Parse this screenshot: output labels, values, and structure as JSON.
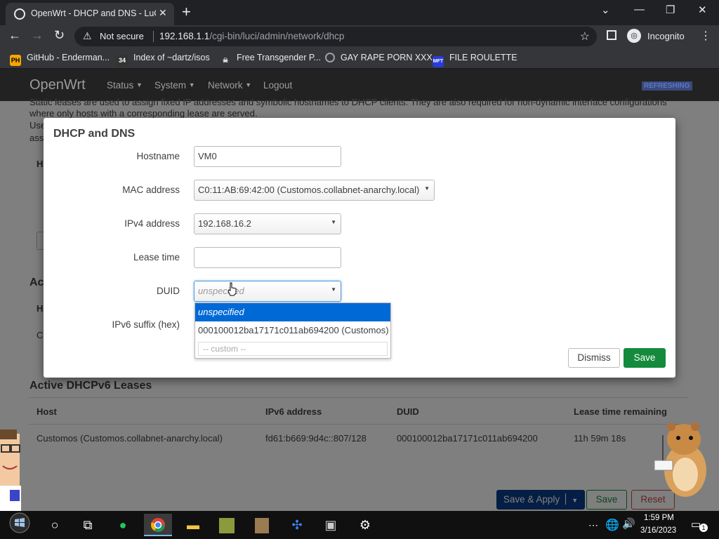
{
  "browser": {
    "tab_title": "OpenWrt - DHCP and DNS - LuCI",
    "not_secure": "Not secure",
    "url_host": "192.168.1.1",
    "url_path": "/cgi-bin/luci/admin/network/dhcp",
    "profile": "Incognito",
    "bookmarks": [
      {
        "label": "GitHub - Enderman...",
        "icon": "PH",
        "color": "#f7a800"
      },
      {
        "label": "Index of ~dartz/isos",
        "icon": "34",
        "color": "#333333"
      },
      {
        "label": "Free Transgender P...",
        "icon": "skull",
        "color": "#e8eaed"
      },
      {
        "label": "GAY RAPE PORN XXX",
        "icon": "globe",
        "color": "#9aa0a6"
      },
      {
        "label": "FILE ROULETTE",
        "icon": "MFT",
        "color": "#2a3bd6"
      }
    ]
  },
  "openwrt": {
    "brand": "OpenWrt",
    "menu": [
      "Status",
      "System",
      "Network",
      "Logout"
    ],
    "badge": "REFRESHING",
    "bg_text_1": "Static leases are used to assign fixed IP addresses and symbolic hostnames to DHCP clients. They are also required for non-dynamic interface configurations",
    "bg_text_2": "where only hosts with a corresponding lease are served.",
    "bg_frag_us": "Use",
    "bg_frag_as": "ass",
    "bg_frag_h": "H",
    "bg_frag_act": "Act",
    "bg_frag_h2": "H",
    "bg_frag_c": "C",
    "v6_heading": "Active DHCPv6 Leases",
    "v6_headers": [
      "Host",
      "IPv6 address",
      "DUID",
      "Lease time remaining"
    ],
    "v6_row": [
      "Customos (Customos.collabnet-anarchy.local)",
      "fd61:b669:9d4c::807/128",
      "000100012ba17171c011ab694200",
      "11h 59m 18s"
    ],
    "footer": {
      "save_apply": "Save & Apply",
      "save": "Save",
      "reset": "Reset"
    }
  },
  "modal": {
    "title": "DHCP and DNS",
    "hostname_label": "Hostname",
    "hostname_value": "VM0",
    "mac_label": "MAC address",
    "mac_value": "C0:11:AB:69:42:00 (Customos.collabnet-anarchy.local)",
    "ipv4_label": "IPv4 address",
    "ipv4_value": "192.168.16.2",
    "lease_label": "Lease time",
    "lease_value": "",
    "duid_label": "DUID",
    "duid_placeholder": "unspecified",
    "ipv6_label": "IPv6 suffix (hex)",
    "duid_options": [
      "unspecified",
      "000100012ba17171c011ab694200 (Customos)"
    ],
    "custom_placeholder": "-- custom --",
    "dismiss": "Dismiss",
    "save": "Save"
  },
  "taskbar": {
    "time": "1:59 PM",
    "date": "3/16/2023",
    "notifications": "1"
  },
  "colors": {
    "save_green": "#138a3c",
    "selection_blue": "#0069d6",
    "apply_blue": "#0a3c8a"
  }
}
